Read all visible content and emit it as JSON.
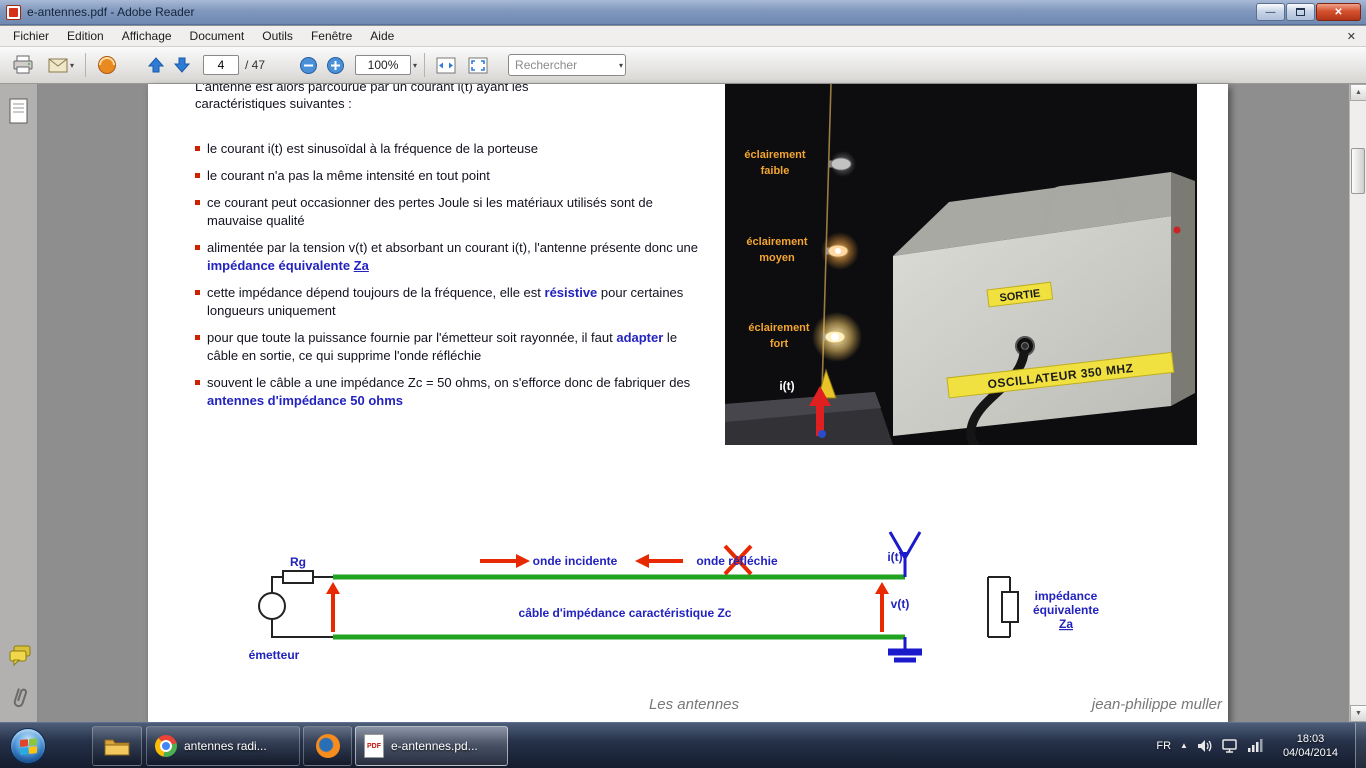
{
  "titlebar": {
    "title": "e-antennes.pdf - Adobe Reader"
  },
  "menubar": {
    "items": [
      "Fichier",
      "Edition",
      "Affichage",
      "Document",
      "Outils",
      "Fenêtre",
      "Aide"
    ]
  },
  "toolbar": {
    "page_value": "4",
    "page_total": "/ 47",
    "zoom_value": "100%",
    "search_placeholder": "Rechercher"
  },
  "icons": {
    "close_x": "✕",
    "minimize": "—",
    "caret_down": "▾",
    "scroll_up": "▲",
    "scroll_down": "▼",
    "tray_hidden": "▲"
  },
  "page": {
    "intro_lines": [
      "L'antenne est alors parcourue par un courant i(t) ayant les",
      "caractéristiques suivantes :"
    ],
    "bullets": [
      {
        "segments": [
          {
            "t": "le courant i(t) est sinusoïdal à la fréquence de la porteuse"
          }
        ]
      },
      {
        "segments": [
          {
            "t": "le courant n'a pas la même intensité en tout point"
          }
        ]
      },
      {
        "segments": [
          {
            "t": "ce courant peut occasionner des pertes Joule si les matériaux utilisés sont de mauvaise qualité"
          }
        ]
      },
      {
        "segments": [
          {
            "t": "alimentée par la tension v(t) et absorbant un courant i(t), l'antenne présente donc une "
          },
          {
            "t": "impédance équivalente ",
            "b": true
          },
          {
            "t": "Za",
            "b": true,
            "u": true
          }
        ]
      },
      {
        "segments": [
          {
            "t": "cette impédance dépend toujours de la fréquence, elle est "
          },
          {
            "t": "résistive",
            "b": true
          },
          {
            "t": " pour certaines longueurs uniquement"
          }
        ]
      },
      {
        "segments": [
          {
            "t": "pour que toute la puissance fournie par l'émetteur soit rayonnée, il faut "
          },
          {
            "t": "adapter",
            "b": true
          },
          {
            "t": " le câble en sortie, ce qui supprime l'onde réfléchie"
          }
        ]
      },
      {
        "segments": [
          {
            "t": "souvent le câble a une impédance Zc = 50 ohms, on s'efforce donc de fabriquer des "
          },
          {
            "t": "antennes d'impédance 50 ohms",
            "b": true
          }
        ]
      }
    ],
    "photo": {
      "label_faible": [
        "éclairement",
        "faible"
      ],
      "label_moyen": [
        "éclairement",
        "moyen"
      ],
      "label_fort": [
        "éclairement",
        "fort"
      ],
      "current_label": "i(t)",
      "sortie_label": "SORTIE",
      "oscillator_label": "OSCILLATEUR 350 MHZ"
    },
    "diagram": {
      "rg": "Rg",
      "onde_incidente": "onde incidente",
      "onde_reflechie": "onde réfléchie",
      "i_t": "i(t)",
      "v_t": "v(t)",
      "cable": "câble d'impédance caractéristique Zc",
      "emetteur": "émetteur",
      "impedance_lines": [
        "impédance",
        "équivalente",
        "Za"
      ]
    },
    "footer": {
      "left": "Les antennes",
      "right": "jean-philippe muller"
    }
  },
  "taskbar": {
    "chrome_label": "antennes radi...",
    "pdf_label": "e-antennes.pd...",
    "tray": {
      "lang": "FR",
      "time": "18:03",
      "date": "04/04/2014"
    }
  },
  "colors": {
    "highlight_blue": "#2323bf",
    "bullet_red": "#cc2200",
    "diagram_green": "#21a321",
    "arrow_red": "#e82800",
    "photo_label_orange": "#f3a52f"
  }
}
